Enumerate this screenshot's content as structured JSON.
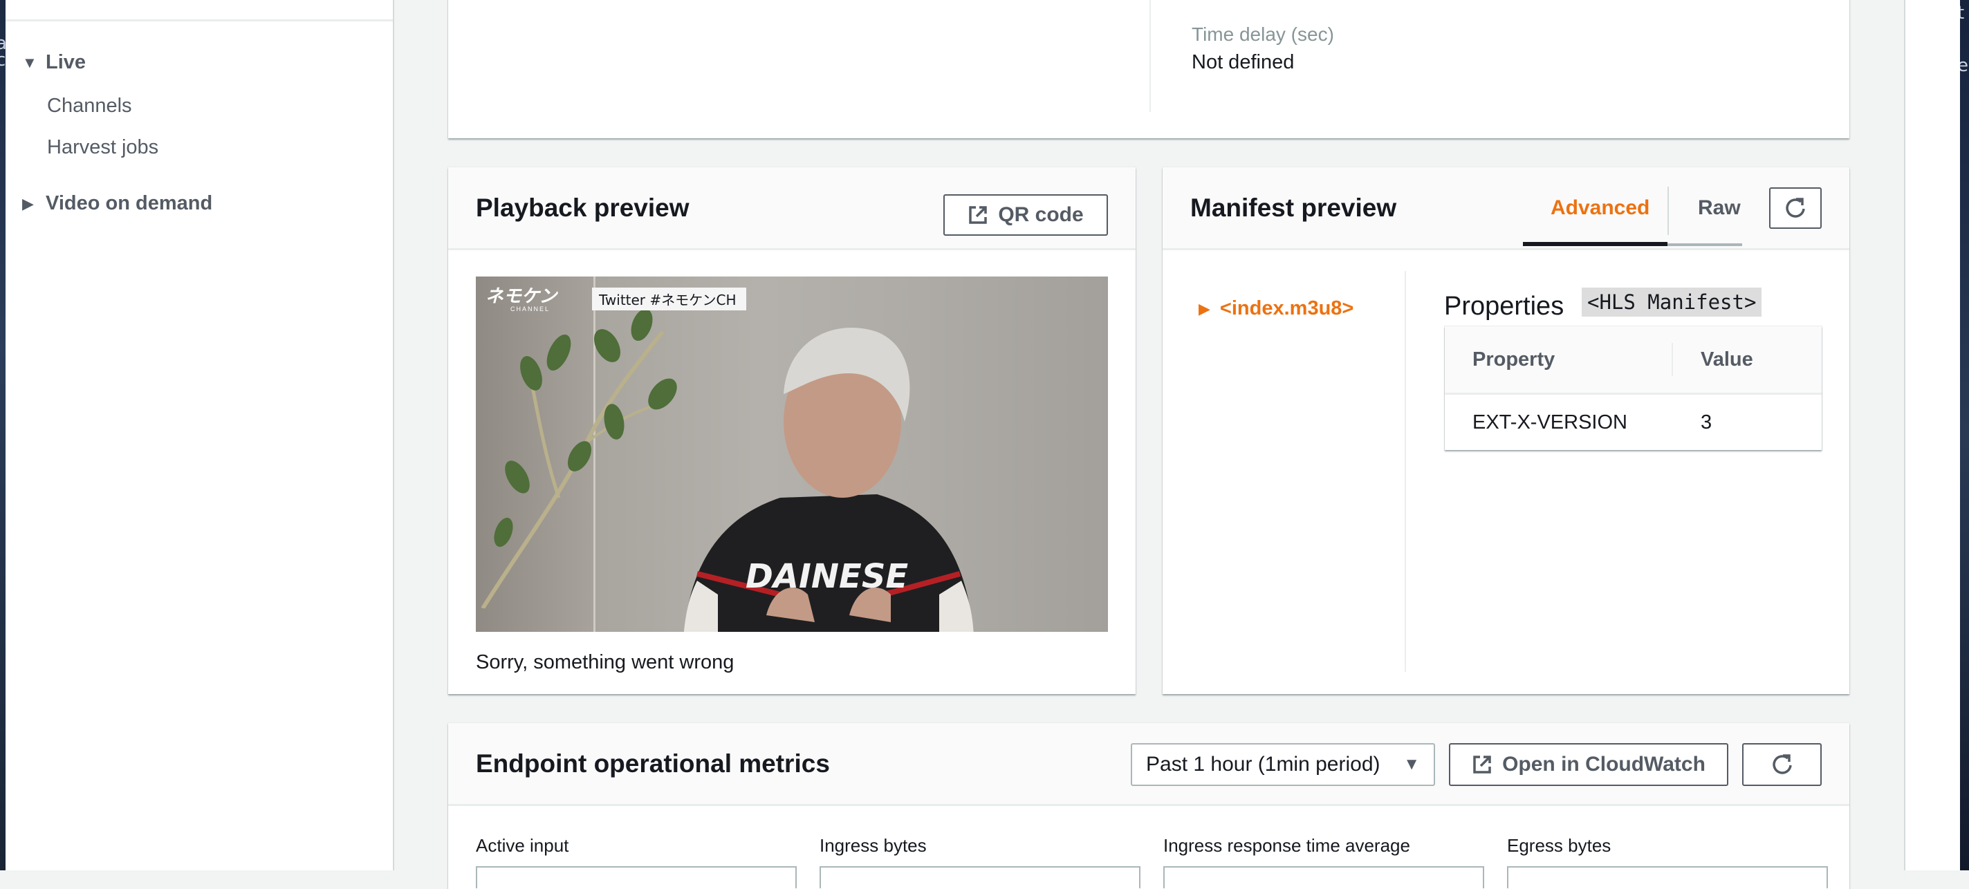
{
  "desktop": {
    "left_fragments": [
      "a",
      "c"
    ],
    "right_fragments": [
      "t",
      "e"
    ]
  },
  "sidebar": {
    "sections": [
      {
        "label": "Live",
        "expanded": true,
        "items": [
          {
            "label": "Channels"
          },
          {
            "label": "Harvest jobs"
          }
        ]
      },
      {
        "label": "Video on demand",
        "expanded": false,
        "items": []
      }
    ]
  },
  "details": {
    "time_delay_label": "Time delay (sec)",
    "time_delay_value": "Not defined"
  },
  "playback": {
    "title": "Playback preview",
    "qr_button": "QR code",
    "video_overlay_logo": "ネモケン",
    "video_overlay_logo_sub": "CHANNEL",
    "video_overlay_caption": "Twitter #ネモケンCH",
    "error": "Sorry, something went wrong"
  },
  "manifest": {
    "title": "Manifest preview",
    "tabs": [
      {
        "label": "Advanced",
        "active": true
      },
      {
        "label": "Raw",
        "active": false
      }
    ],
    "tree_item": "<index.m3u8>",
    "properties_title": "Properties",
    "properties_badge": "<HLS Manifest>",
    "table": {
      "headers": [
        "Property",
        "Value"
      ],
      "rows": [
        [
          "EXT-X-VERSION",
          "3"
        ]
      ]
    }
  },
  "metrics": {
    "title": "Endpoint operational metrics",
    "period_select": "Past 1 hour (1min period)",
    "cloudwatch_button": "Open in CloudWatch",
    "labels": [
      "Active input",
      "Ingress bytes",
      "Ingress response time average",
      "Egress bytes"
    ]
  },
  "colors": {
    "accent": "#ec7211",
    "text": "#16191f",
    "muted": "#879596",
    "icon": "#545b64",
    "background": "#f2f3f3"
  }
}
